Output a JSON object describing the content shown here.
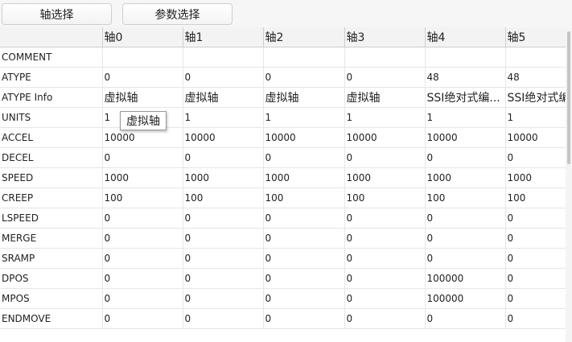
{
  "toolbar": {
    "axis_select_label": "轴选择",
    "param_select_label": "参数选择"
  },
  "table": {
    "columns": [
      "",
      "轴0",
      "轴1",
      "轴2",
      "轴3",
      "轴4",
      "轴5"
    ],
    "rows": [
      {
        "name": "COMMENT",
        "values": [
          "",
          "",
          "",
          "",
          "",
          ""
        ]
      },
      {
        "name": "ATYPE",
        "values": [
          "0",
          "0",
          "0",
          "0",
          "48",
          "48"
        ]
      },
      {
        "name": "ATYPE Info",
        "values": [
          "虚拟轴",
          "虚拟轴",
          "虚拟轴",
          "虚拟轴",
          "SSI绝对式编...",
          "SSI绝对式编..."
        ]
      },
      {
        "name": "UNITS",
        "values": [
          "1",
          "1",
          "1",
          "1",
          "1",
          "1"
        ]
      },
      {
        "name": "ACCEL",
        "values": [
          "10000",
          "10000",
          "10000",
          "10000",
          "10000",
          "10000"
        ]
      },
      {
        "name": "DECEL",
        "values": [
          "0",
          "0",
          "0",
          "0",
          "0",
          "0"
        ]
      },
      {
        "name": "SPEED",
        "values": [
          "1000",
          "1000",
          "1000",
          "1000",
          "1000",
          "1000"
        ]
      },
      {
        "name": "CREEP",
        "values": [
          "100",
          "100",
          "100",
          "100",
          "100",
          "100"
        ]
      },
      {
        "name": "LSPEED",
        "values": [
          "0",
          "0",
          "0",
          "0",
          "0",
          "0"
        ]
      },
      {
        "name": "MERGE",
        "values": [
          "0",
          "0",
          "0",
          "0",
          "0",
          "0"
        ]
      },
      {
        "name": "SRAMP",
        "values": [
          "0",
          "0",
          "0",
          "0",
          "0",
          "0"
        ]
      },
      {
        "name": "DPOS",
        "values": [
          "0",
          "0",
          "0",
          "0",
          "100000",
          "0"
        ]
      },
      {
        "name": "MPOS",
        "values": [
          "0",
          "0",
          "0",
          "0",
          "100000",
          "0"
        ]
      },
      {
        "name": "ENDMOVE",
        "values": [
          "0",
          "0",
          "0",
          "0",
          "0",
          "0"
        ]
      }
    ]
  },
  "tooltip": {
    "text": "虚拟轴"
  }
}
